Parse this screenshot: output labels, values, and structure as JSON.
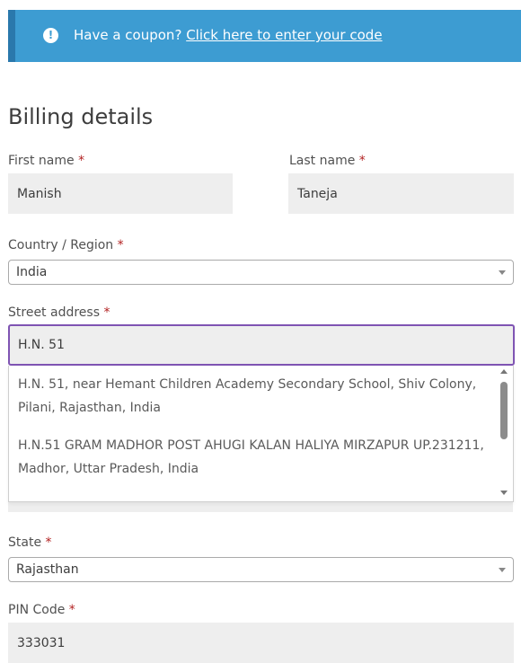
{
  "notice": {
    "icon": "info-icon",
    "text": "Have a coupon?",
    "link": "Click here to enter your code"
  },
  "heading": "Billing details",
  "required_mark": "*",
  "first_name": {
    "label": "First name",
    "value": "Manish"
  },
  "last_name": {
    "label": "Last name",
    "value": "Taneja"
  },
  "country": {
    "label": "Country / Region",
    "value": "India"
  },
  "street": {
    "label": "Street address",
    "value": "H.N. 51",
    "suggestions": [
      "H.N. 51, near Hemant Children Academy Secondary School, Shiv Colony, Pilani, Rajasthan, India",
      "H.N.51 GRAM MADHOR POST AHUGI KALAN HALIYA MIRZAPUR UP.231211, Madhor, Uttar Pradesh, India"
    ]
  },
  "state": {
    "label": "State",
    "value": "Rajasthan"
  },
  "pin": {
    "label": "PIN Code",
    "value": "333031"
  },
  "colors": {
    "notice_bg": "#3d9cd2",
    "focus_border": "#7f54b3",
    "required": "#b22222"
  }
}
